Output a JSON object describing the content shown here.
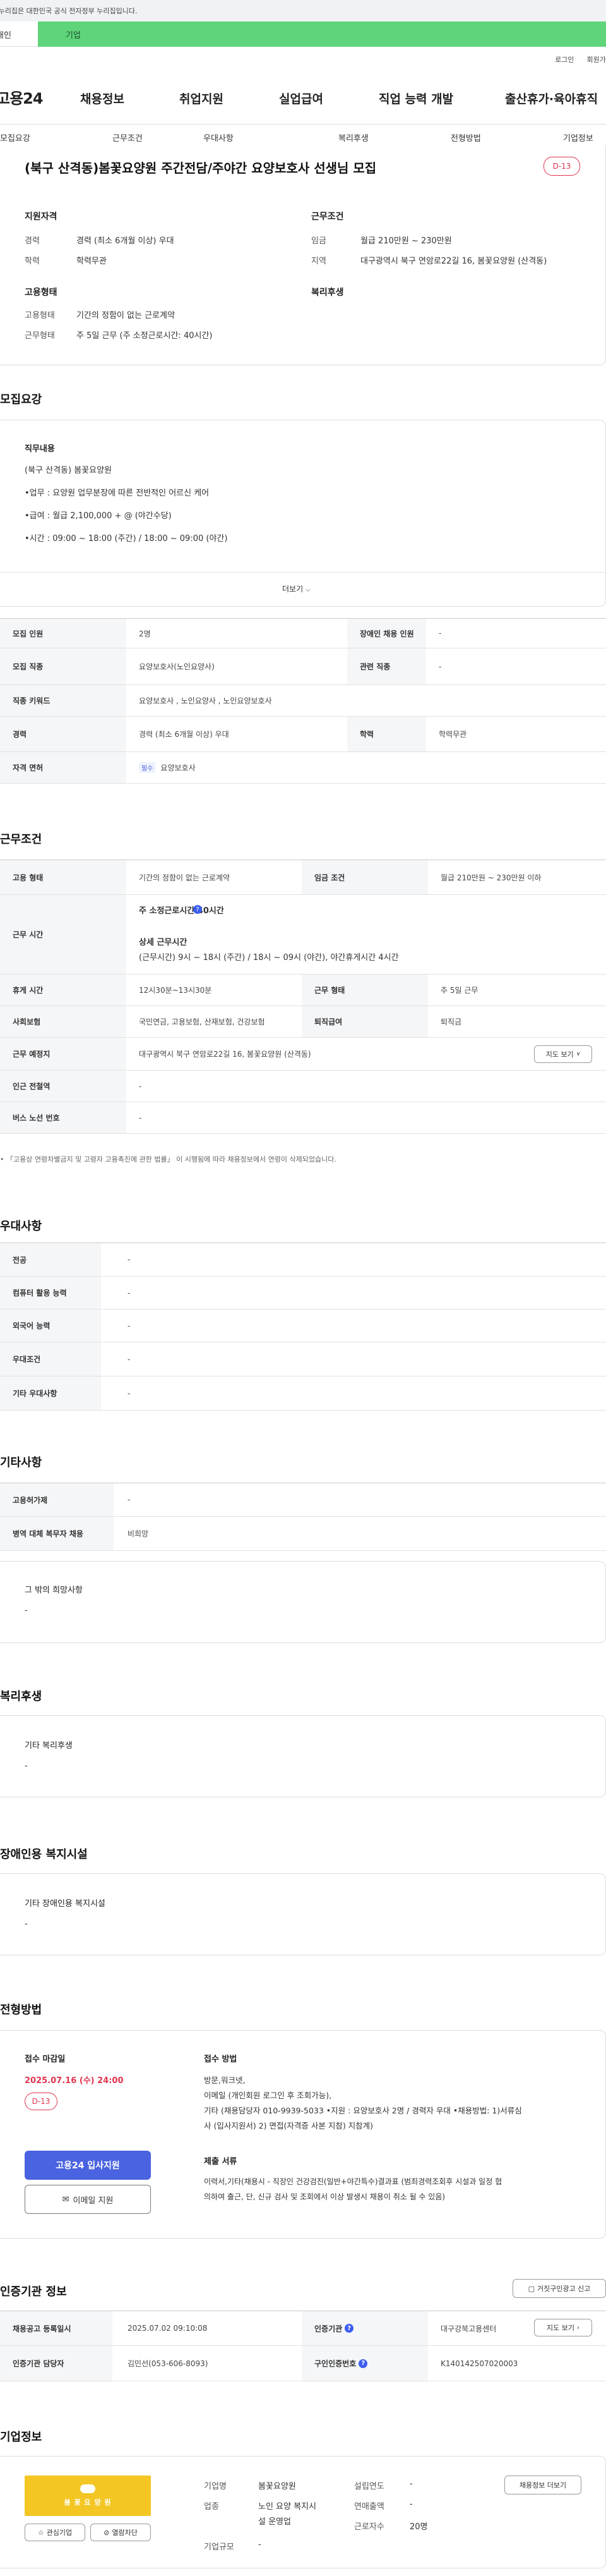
{
  "gov_banner": {
    "text": "이 누리집은 대한민국 공식 전자정부 누리집입니다."
  },
  "tabs": {
    "individual": "개인",
    "company": "기업"
  },
  "util": {
    "login": "로그인",
    "join": "회원가입"
  },
  "logo": {
    "text": "고용24"
  },
  "gnb": [
    "채용정보",
    "취업지원",
    "실업급여",
    "직업 능력 개발",
    "출산휴가·육아휴직"
  ],
  "subnav": [
    "모집요강",
    "근무조건",
    "우대사항",
    "복리후생",
    "전형방법",
    "기업정보"
  ],
  "job": {
    "title": "(북구 산격동)봄꽃요양원 주간전담/주야간 요양보호사 선생님 모집",
    "dday": "D-13",
    "qual_title": "지원자격",
    "qual": [
      {
        "label": "경력",
        "value": "경력 (최소 6개월 이상) 우대"
      },
      {
        "label": "학력",
        "value": "학력무관"
      }
    ],
    "cond_title": "근무조건",
    "cond": [
      {
        "label": "임금",
        "value": "월급 210만원 ~ 230만원"
      },
      {
        "label": "지역",
        "value": "대구광역시 북구 연암로22길 16, 봄꽃요양원 (산격동)"
      }
    ],
    "emp_title": "고용형태",
    "emp": [
      {
        "label": "고용형태",
        "value": "기간의 정함이 없는 근로계약"
      },
      {
        "label": "근무형태",
        "value": "주 5일 근무 (주 소정근로시간: 40시간)"
      }
    ],
    "welfare_title": "복리후생"
  },
  "recruit": {
    "heading": "모집요강",
    "duty_title": "직무내용",
    "duty_lines": [
      "(북구 산격동) 봄꽃요양원",
      "•업무 :  요양원 업무분장에 따른 전반적인 어르신 케어",
      "•급여 :  월급 2,100,000 + @ (야간수당)",
      "•시간 :  09:00 ~ 18:00 (주간) / 18:00 ~ 09:00 (야간)"
    ],
    "more": "더보기",
    "table": [
      {
        "th": "모집 인원",
        "td": "2명",
        "th2": "장애인 채용 인원",
        "td2": "-"
      },
      {
        "th": "모집 직종",
        "td": "요양보호사(노인요양사)",
        "th2": "관련 직종",
        "td2": "-"
      },
      {
        "th": "직종 키워드",
        "td": "요양보호사 , 노인요양사 , 노인요양보호사"
      },
      {
        "th": "경력",
        "td": "경력 (최소 6개월 이상) 우대",
        "th2": "학력",
        "td2": "학력무관"
      },
      {
        "th": "자격 면허",
        "tag": "필수",
        "td": "요양보호사"
      }
    ]
  },
  "work": {
    "heading": "근무조건",
    "emp_type_th": "고용 형태",
    "emp_type_td": "기간의 정함이 없는 근로계약",
    "wage_th": "임금 조건",
    "wage_td": "월급 210만원 ~ 230만원 이하",
    "hours_th": "근무 시간",
    "hours_main": "주 소정근로시간  40시간",
    "hours_detail_title": "상세 근무시간",
    "hours_detail": "(근무시간) 9시 ~ 18시 (주간) / 18시 ~ 09시 (야간), 야간휴게시간 4시간",
    "break_th": "휴게 시간",
    "break_td": "12시30분~13시30분",
    "form_th": "근무 형태",
    "form_td": "주 5일 근무",
    "ins_th": "사회보험",
    "ins_td": "국민연금, 고용보험, 산재보험, 건강보험",
    "sev_th": "퇴직급여",
    "sev_td": "퇴직금",
    "place_th": "근무 예정지",
    "place_td": "대구광역시 북구 연암로22길 16, 봄꽃요양원 (산격동)",
    "map_btn": "지도 보기",
    "subway_th": "인근 전철역",
    "subway_td": "-",
    "bus_th": "버스 노선 번호",
    "bus_td": "-",
    "note": "「고용상 연령차별금지 및 고령자 고용촉진에 관한 법률」 이 시행됨에 따라 채용정보에서 연령이 삭제되었습니다."
  },
  "pref": {
    "heading": "우대사항",
    "rows": [
      {
        "th": "전공",
        "td": "-"
      },
      {
        "th": "컴퓨터 활용 능력",
        "td": "-"
      },
      {
        "th": "외국어 능력",
        "td": "-"
      },
      {
        "th": "우대조건",
        "td": "-"
      },
      {
        "th": "기타 우대사항",
        "td": "-"
      }
    ]
  },
  "etc": {
    "heading": "기타사항",
    "rows": [
      {
        "th": "고용허가제",
        "td": "-"
      },
      {
        "th": "병역 대체 복무자 채용",
        "td": "비희망"
      }
    ],
    "hope_title": "그 밖의 희망사항",
    "hope_value": "-"
  },
  "benefit": {
    "heading": "복리후생",
    "title": "기타 복리후생",
    "value": "-"
  },
  "disabled": {
    "heading": "장애인용 복지시설",
    "title": "기타 장애인용 복지시설",
    "value": "-"
  },
  "process": {
    "heading": "전형방법",
    "deadline_title": "접수 마감일",
    "deadline": "2025.07.16 (수) 24:00",
    "dday": "D-13",
    "apply_btn": "고용24 입사지원",
    "email_btn": "이메일 지원",
    "method_title": "접수 방법",
    "method_lines": [
      "방문,워크넷,",
      "이메일 (개인회원 로그인 후 조회가능),",
      "기타 (채용담당자 010-9939-5033 •지원 : 요양보호사 2명 / 경력자 우대 •채용방법: 1)서류심",
      "사 (입사지원서)        2)  면접(자격증 사본 지참)    지참계)"
    ],
    "docs_title": "제출 서류",
    "docs_lines": [
      "이력서,기타(채용시    -   직장인 건강검진(일반+야간특수)결과표 (범죄경력조회후 시설과 일정 협",
      "의하여 출근, 단, 신규 검사 및 조회에서 이상 발생시 채용이 취소 될 수 있음)"
    ]
  },
  "cert": {
    "heading": "인증기관 정보",
    "false_ad_btn": "거짓구인광고 신고",
    "reg_th": "채용공고 등록일시",
    "reg_td": "2025.07.02 09:10:08",
    "org_th": "인증기관",
    "org_td": "대구강북고용센터",
    "map_btn": "지도 보기",
    "mgr_th": "인증기관 담당자",
    "mgr_td": "김민선(053-606-8093)",
    "no_th": "구인인증번호",
    "no_td": "K140142507020003"
  },
  "company": {
    "heading": "기업정보",
    "logo_text": "봄 꽃 요 양 원",
    "fav_btn": "관심기업",
    "block_btn": "열람차단",
    "name_lbl": "기업명",
    "name": "봄꽃요양원",
    "founded_lbl": "설립연도",
    "founded": "-",
    "industry_lbl": "업종",
    "industry_1": "노인 요양 복지시",
    "industry_2": "설 운영업",
    "revenue_lbl": "연매출액",
    "revenue": "-",
    "emp_lbl": "근로자수",
    "emp": "20명",
    "size_lbl": "기업규모",
    "size": "-",
    "more_btn": "채용정보 더보기"
  }
}
